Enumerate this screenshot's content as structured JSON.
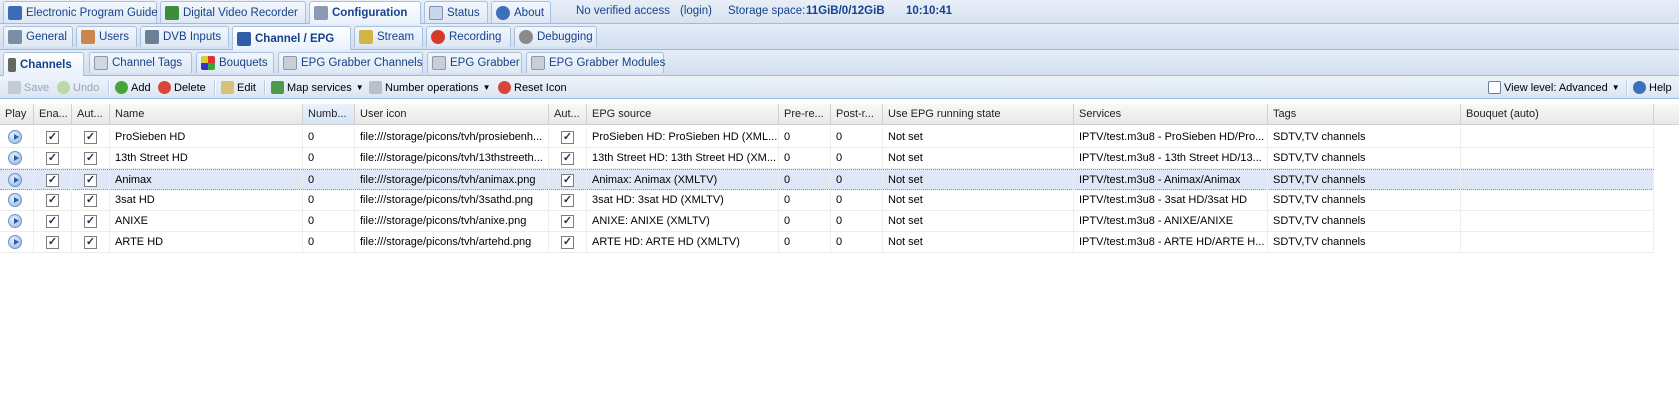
{
  "header": {
    "tabs": [
      {
        "label": "Electronic Program Guide",
        "icon": "epg-icon",
        "active": false
      },
      {
        "label": "Digital Video Recorder",
        "icon": "dvr-icon",
        "active": false
      },
      {
        "label": "Configuration",
        "icon": "wrench-icon",
        "active": true
      },
      {
        "label": "Status",
        "icon": "eye-icon",
        "active": false
      },
      {
        "label": "About",
        "icon": "info-icon",
        "active": false
      }
    ],
    "access": "No verified access",
    "login": "(login)",
    "storage_label": "Storage space:",
    "storage_value": "11GiB/0/12GiB",
    "time": "10:10:41"
  },
  "config_tabs": [
    {
      "label": "General",
      "icon": "tools-icon"
    },
    {
      "label": "Users",
      "icon": "users-icon"
    },
    {
      "label": "DVB Inputs",
      "icon": "dvb-icon"
    },
    {
      "label": "Channel / EPG",
      "icon": "tv-icon",
      "active": true
    },
    {
      "label": "Stream",
      "icon": "stream-icon"
    },
    {
      "label": "Recording",
      "icon": "rec-icon"
    },
    {
      "label": "Debugging",
      "icon": "bug-icon"
    }
  ],
  "channel_tabs": [
    {
      "label": "Channels",
      "icon": "remote-icon",
      "active": true
    },
    {
      "label": "Channel Tags",
      "icon": "tag-icon"
    },
    {
      "label": "Bouquets",
      "icon": "bouquet-icon"
    },
    {
      "label": "EPG Grabber Channels",
      "icon": "grabber-icon"
    },
    {
      "label": "EPG Grabber",
      "icon": "grabber-icon"
    },
    {
      "label": "EPG Grabber Modules",
      "icon": "grabber-icon"
    }
  ],
  "toolbar": {
    "save": "Save",
    "undo": "Undo",
    "add": "Add",
    "delete": "Delete",
    "edit": "Edit",
    "map_services": "Map services",
    "number_operations": "Number operations",
    "reset_icon": "Reset Icon",
    "view_level": "View level: Advanced",
    "help": "Help"
  },
  "grid": {
    "columns": [
      "Play",
      "Ena...",
      "Aut...",
      "Name",
      "Numb...",
      "User icon",
      "Aut...",
      "EPG source",
      "Pre-re...",
      "Post-r...",
      "Use EPG running state",
      "Services",
      "Tags",
      "Bouquet (auto)"
    ],
    "rows": [
      {
        "enabled": true,
        "auto_name": true,
        "name": "ProSieben HD",
        "number": "0",
        "icon": "file:///storage/picons/tvh/prosiebenh...",
        "auto_epg": true,
        "epg": "ProSieben HD: ProSieben HD (XML...",
        "pre": "0",
        "post": "0",
        "running": "Not set",
        "services": "IPTV/test.m3u8 - ProSieben HD/Pro...",
        "tags": "SDTV,TV channels",
        "bouquet": "",
        "selected": false
      },
      {
        "enabled": true,
        "auto_name": true,
        "name": "13th Street HD",
        "number": "0",
        "icon": "file:///storage/picons/tvh/13thstreeth...",
        "auto_epg": true,
        "epg": "13th Street HD: 13th Street HD (XM...",
        "pre": "0",
        "post": "0",
        "running": "Not set",
        "services": "IPTV/test.m3u8 - 13th Street HD/13...",
        "tags": "SDTV,TV channels",
        "bouquet": "",
        "selected": false
      },
      {
        "enabled": true,
        "auto_name": true,
        "name": "Animax",
        "number": "0",
        "icon": "file:///storage/picons/tvh/animax.png",
        "auto_epg": true,
        "epg": "Animax: Animax (XMLTV)",
        "pre": "0",
        "post": "0",
        "running": "Not set",
        "services": "IPTV/test.m3u8 - Animax/Animax",
        "tags": "SDTV,TV channels",
        "bouquet": "",
        "selected": true
      },
      {
        "enabled": true,
        "auto_name": true,
        "name": "3sat HD",
        "number": "0",
        "icon": "file:///storage/picons/tvh/3sathd.png",
        "auto_epg": true,
        "epg": "3sat HD: 3sat HD (XMLTV)",
        "pre": "0",
        "post": "0",
        "running": "Not set",
        "services": "IPTV/test.m3u8 - 3sat HD/3sat HD",
        "tags": "SDTV,TV channels",
        "bouquet": "",
        "selected": false
      },
      {
        "enabled": true,
        "auto_name": true,
        "name": "ANIXE",
        "number": "0",
        "icon": "file:///storage/picons/tvh/anixe.png",
        "auto_epg": true,
        "epg": "ANIXE: ANIXE (XMLTV)",
        "pre": "0",
        "post": "0",
        "running": "Not set",
        "services": "IPTV/test.m3u8 - ANIXE/ANIXE",
        "tags": "SDTV,TV channels",
        "bouquet": "",
        "selected": false
      },
      {
        "enabled": true,
        "auto_name": true,
        "name": "ARTE HD",
        "number": "0",
        "icon": "file:///storage/picons/tvh/artehd.png",
        "auto_epg": true,
        "epg": "ARTE HD: ARTE HD (XMLTV)",
        "pre": "0",
        "post": "0",
        "running": "Not set",
        "services": "IPTV/test.m3u8 - ARTE HD/ARTE H...",
        "tags": "SDTV,TV channels",
        "bouquet": "",
        "selected": false
      }
    ]
  },
  "colors": {
    "accent": "#15428b",
    "tab_border": "#99bbe8",
    "selected_row": "#dfe8f6"
  }
}
